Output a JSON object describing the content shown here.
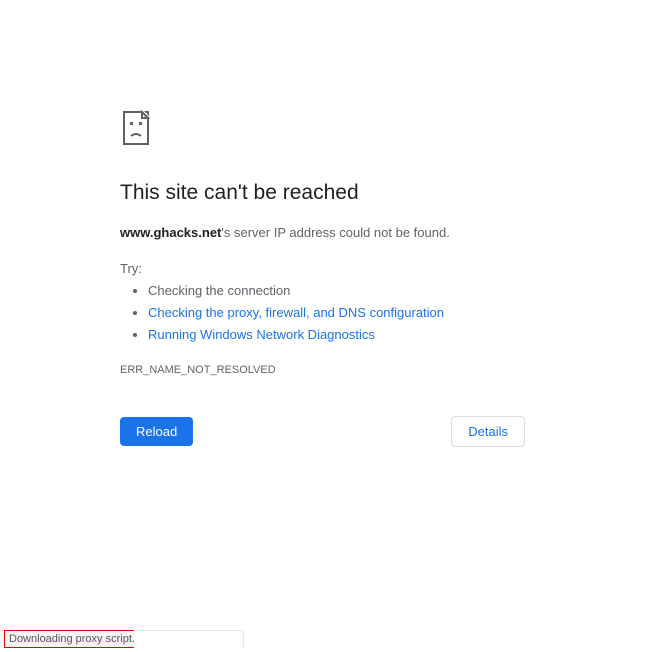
{
  "error": {
    "title": "This site can't be reached",
    "hostname": "www.ghacks.net",
    "subtitle_suffix": "'s server IP address could not be found.",
    "try_label": "Try:",
    "suggestions": [
      {
        "text": "Checking the connection",
        "link": false
      },
      {
        "text": "Checking the proxy, firewall, and DNS configuration",
        "link": true
      },
      {
        "text": "Running Windows Network Diagnostics",
        "link": true
      }
    ],
    "code": "ERR_NAME_NOT_RESOLVED"
  },
  "buttons": {
    "reload": "Reload",
    "details": "Details"
  },
  "status_bar": "Downloading proxy script...",
  "colors": {
    "link": "#1a73e8",
    "text_secondary": "#5f6368",
    "highlight_border": "#e00000"
  }
}
